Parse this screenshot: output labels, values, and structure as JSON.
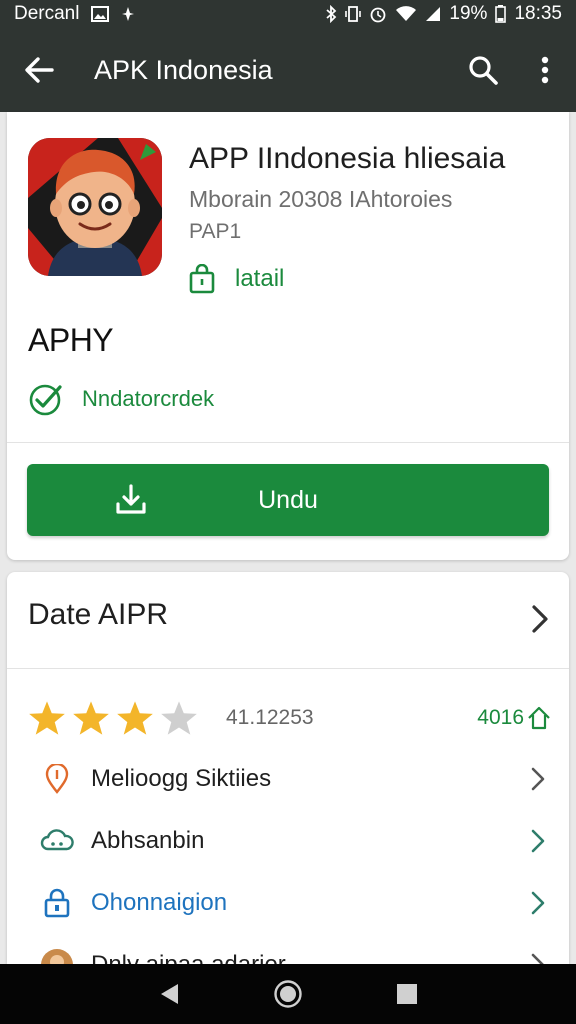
{
  "status_bar": {
    "carrier": "Dercanl",
    "battery": "19%",
    "time": "18:35"
  },
  "app_bar": {
    "title": "APK Indonesia"
  },
  "app": {
    "name": "APP IIndonesia hliesaia",
    "meta1": "Mborain 20308 IAhtoroies",
    "meta2": "PAP1",
    "install_label": "latail",
    "big_title": "APHY",
    "verified_label": "Nndatorcrdek",
    "download_label": "Undu"
  },
  "details": {
    "title": "Date AIPR",
    "rating": {
      "stars_filled": 3,
      "stars_total": 4,
      "count": "41.12253",
      "right_value": "4016"
    },
    "items": [
      {
        "label": "Melioogg Siktiies",
        "icon": "pin-icon",
        "color": "#1f1f1f"
      },
      {
        "label": "Abhsanbin",
        "icon": "cloud-icon",
        "color": "#1f1f1f"
      },
      {
        "label": "Ohonnaigion",
        "icon": "lock-icon",
        "color": "#1e73be"
      },
      {
        "label": "Dnly aipaa adarier",
        "icon": "avatar-icon",
        "color": "#1f1f1f"
      }
    ]
  },
  "colors": {
    "bar": "#2f3532",
    "accent": "#1b8a3d",
    "star": "#f3b52a",
    "link": "#1e73be"
  }
}
